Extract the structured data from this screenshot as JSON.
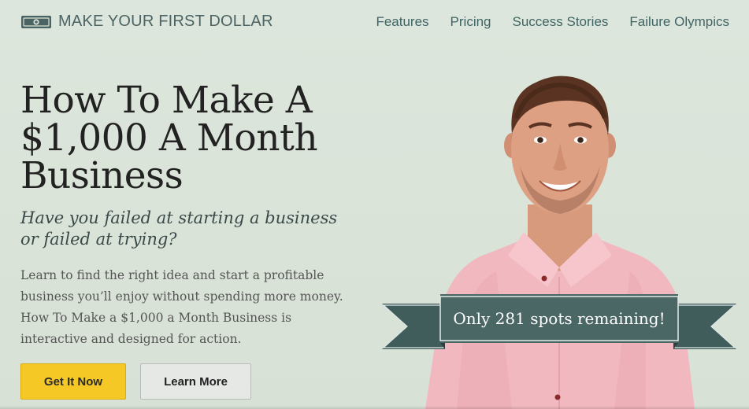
{
  "header": {
    "logo_text": "MAKE YOUR FIRST DOLLAR",
    "logo_icon": "money-bill-icon",
    "nav": [
      {
        "label": "Features"
      },
      {
        "label": "Pricing"
      },
      {
        "label": "Success Stories"
      },
      {
        "label": "Failure Olympics"
      }
    ]
  },
  "hero": {
    "headline_line1": "How To Make A",
    "headline_line2": "$1,000 A Month",
    "headline_line3": "Business",
    "subhead": "Have you failed at starting a business or failed at trying?",
    "body": "Learn to find the right idea and start a profitable business you’ll enjoy without spending more money. How To Make a $1,000 a Month Business is interactive and designed for action.",
    "primary_button": "Get It Now",
    "secondary_button": "Learn More"
  },
  "ribbon": {
    "text": "Only 281 spots remaining!"
  },
  "colors": {
    "background": "#d9e3d8",
    "accent_teal": "#3f6464",
    "ribbon": "#4a6766",
    "primary_button": "#f5c825",
    "shirt": "#f2b7bf"
  }
}
